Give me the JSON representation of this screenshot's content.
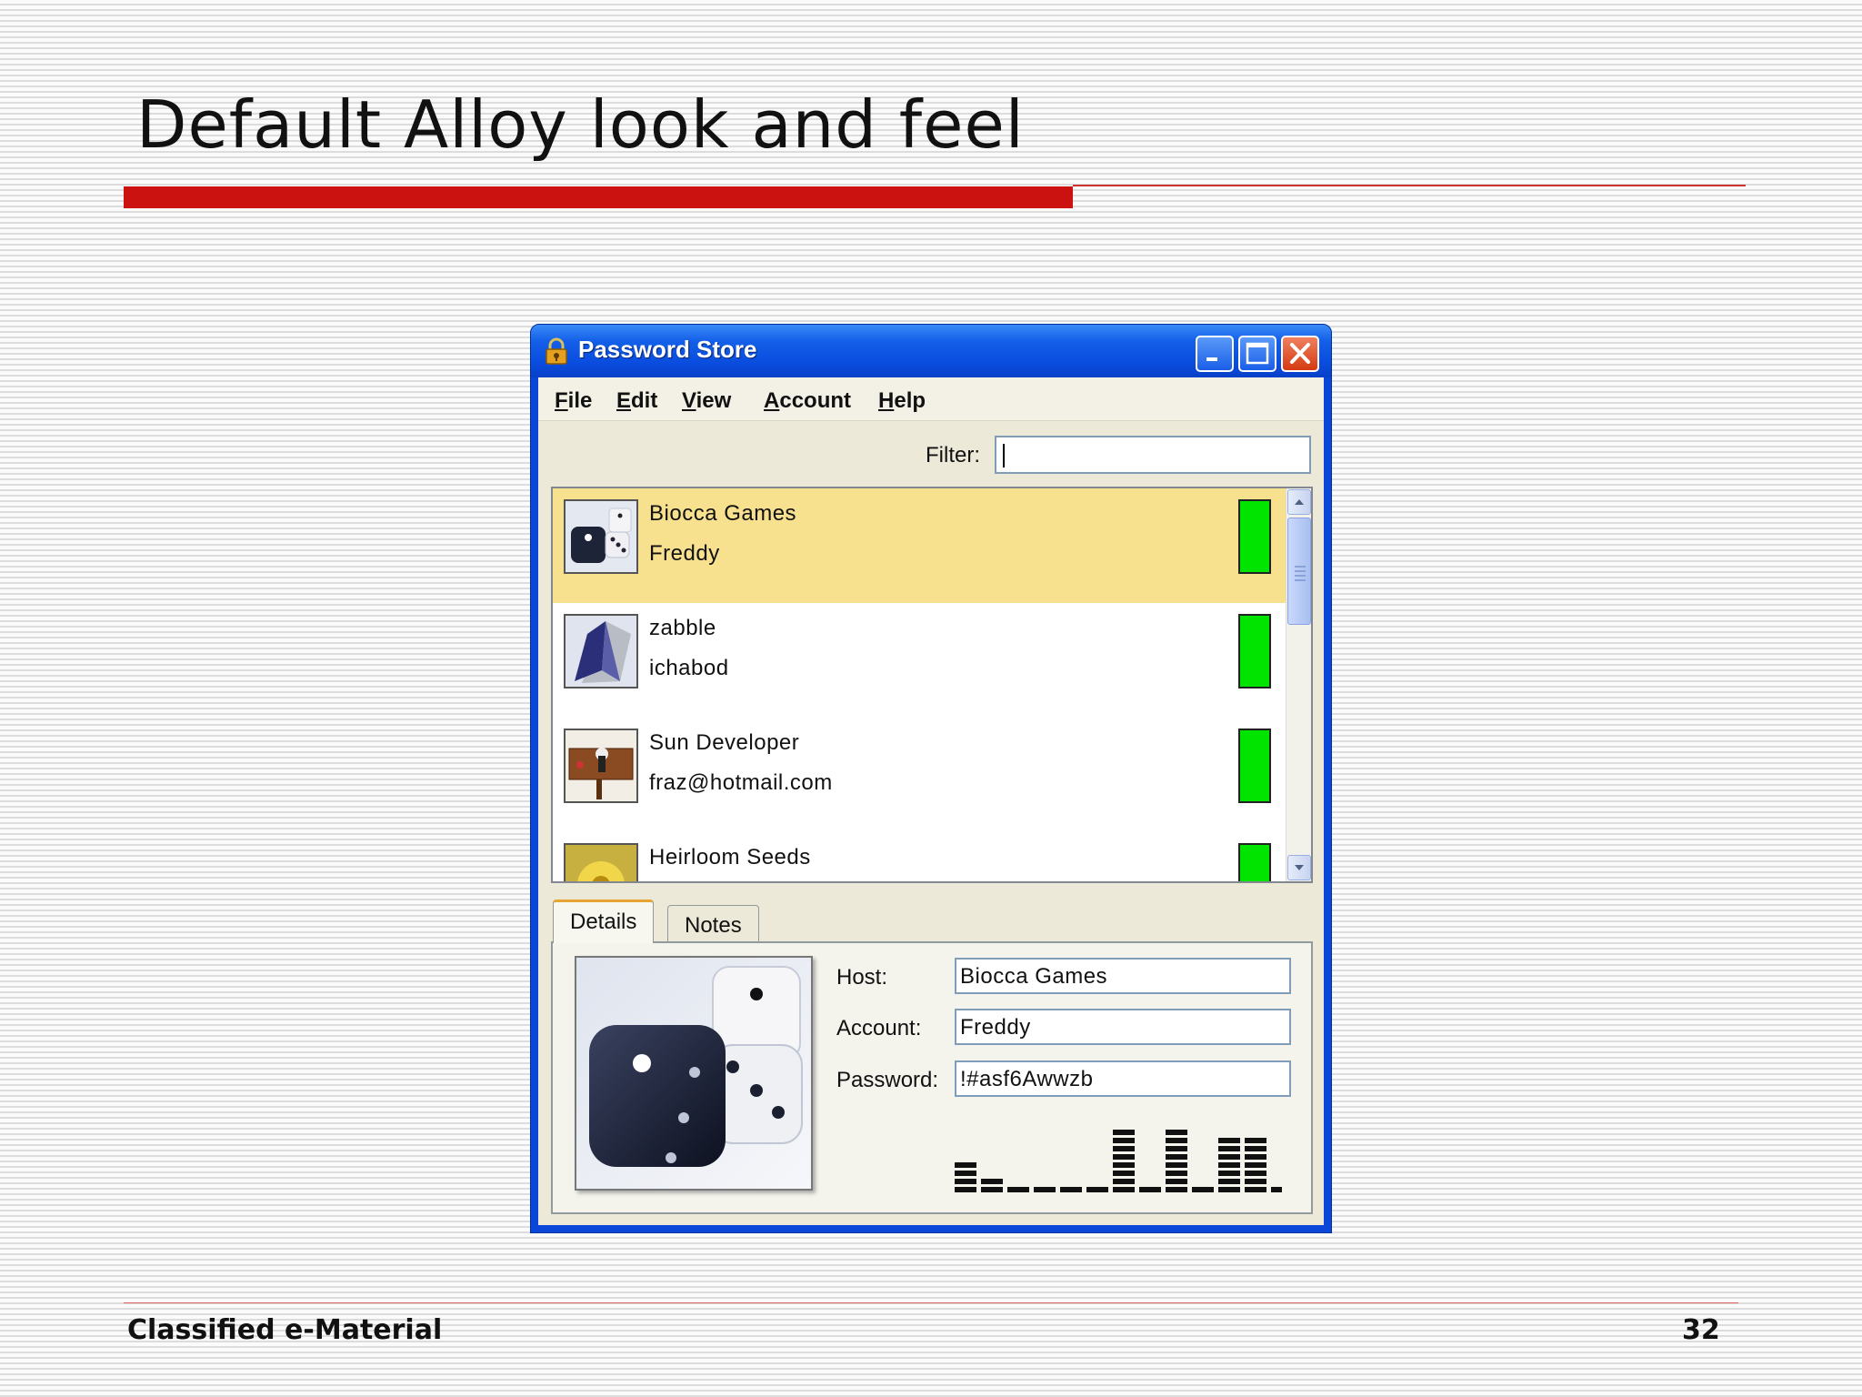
{
  "slide": {
    "title": "Default Alloy look and feel",
    "footer_left": "Classified e-Material",
    "page_number": "32"
  },
  "window": {
    "title": "Password Store",
    "title_icon": "padlock-icon",
    "controls": [
      "minimize-icon",
      "maximize-icon",
      "close-icon"
    ]
  },
  "menu": {
    "file": {
      "mnemonic": "F",
      "rest": "ile"
    },
    "edit": {
      "mnemonic": "E",
      "rest": "dit"
    },
    "view": {
      "mnemonic": "V",
      "rest": "iew"
    },
    "account": {
      "mnemonic": "A",
      "rest": "ccount"
    },
    "help": {
      "mnemonic": "H",
      "rest": "elp"
    }
  },
  "filter": {
    "label": "Filter:",
    "value": ""
  },
  "entries": [
    {
      "host": "Biocca Games",
      "account": "Freddy",
      "selected": true,
      "icon": "dice-thumbnail",
      "strength_color": "#00e400"
    },
    {
      "host": "zabble",
      "account": "ichabod",
      "selected": false,
      "icon": "crystal-thumbnail",
      "strength_color": "#00e400"
    },
    {
      "host": "Sun Developer",
      "account": "fraz@hotmail.com",
      "selected": false,
      "icon": "sign-thumbnail",
      "strength_color": "#00e400"
    },
    {
      "host": "Heirloom Seeds",
      "account": "",
      "selected": false,
      "icon": "flower-thumbnail",
      "strength_color": "#00e400"
    }
  ],
  "tabs": {
    "details": "Details",
    "notes": "Notes"
  },
  "details": {
    "host_label": "Host:",
    "host_value": "Biocca Games",
    "account_label": "Account:",
    "account_value": "Freddy",
    "password_label": "Password:",
    "password_value": "!#asf6Awwzb",
    "password_char_levels": [
      3,
      1,
      0,
      0,
      0,
      0,
      7,
      0,
      7,
      0,
      6,
      6
    ]
  },
  "colors": {
    "accent_red": "#cc1111",
    "selection": "#f7e08e",
    "strength_good": "#00e400",
    "window_blue": "#0a46d8"
  }
}
